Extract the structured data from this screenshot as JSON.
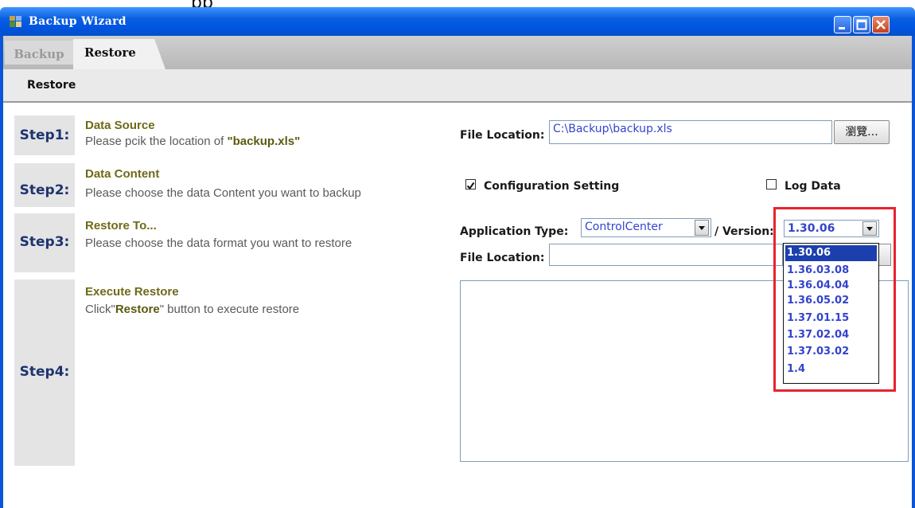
{
  "window": {
    "title": "Backup Wizard",
    "partial_top_text": "pp"
  },
  "tabs": [
    {
      "label": "Backup",
      "active": false
    },
    {
      "label": "Restore",
      "active": true
    }
  ],
  "subbar": {
    "label": "Restore"
  },
  "steps": [
    {
      "label": "Step1:",
      "title": "Data Source",
      "desc_pre": "Please pcik the location of ",
      "desc_bold": "\"backup.xls\"",
      "desc_post": ""
    },
    {
      "label": "Step2:",
      "title": "Data Content",
      "desc_pre": "Please choose the data Content you want to backup",
      "desc_bold": "",
      "desc_post": ""
    },
    {
      "label": "Step3:",
      "title": "Restore To...",
      "desc_pre": "Please choose the data format you want to restore",
      "desc_bold": "",
      "desc_post": ""
    },
    {
      "label": "Step4:",
      "title": "Execute Restore",
      "desc_pre": "Click\"",
      "desc_bold": "Restore",
      "desc_post": "\" button to execute restore"
    }
  ],
  "form": {
    "file_location_label": "File Location:",
    "file_location_value": "C:\\Backup\\backup.xls",
    "browse_label": "瀏覽...",
    "config_label": "Configuration Setting",
    "config_checked": true,
    "log_label": "Log Data",
    "log_checked": false,
    "app_type_label": "Application Type:",
    "app_type_value": "ControlCenter",
    "version_label": "/ Version:",
    "version_value": "1.30.06",
    "file_location2_label": "File Location:"
  },
  "version_options": [
    "1.30.06",
    "1.36.03.08",
    "1.36.04.04",
    "1.36.05.02",
    "1.37.01.15",
    "1.37.02.04",
    "1.37.03.02",
    "1.4"
  ],
  "colors": {
    "highlight": "#e8232e",
    "titlebar": "#0054e3",
    "selected": "#1c3fae"
  }
}
